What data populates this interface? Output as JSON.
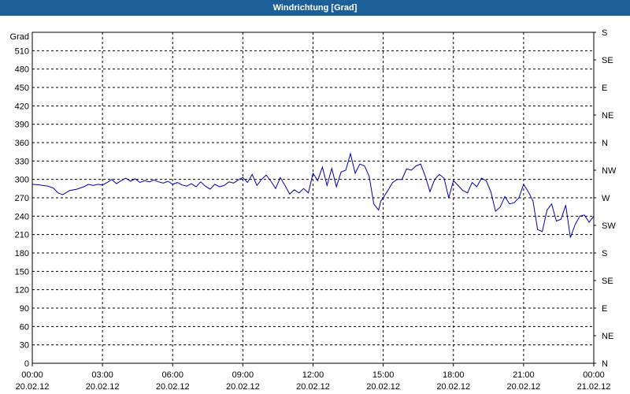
{
  "window": {
    "title": "Windrichtung [Grad]"
  },
  "chart_data": {
    "type": "line",
    "title": "Windrichtung [Grad]",
    "ylabel": "Grad",
    "ylim": [
      0,
      540
    ],
    "y_ticks": [
      0,
      30,
      60,
      90,
      120,
      150,
      180,
      210,
      240,
      270,
      300,
      330,
      360,
      390,
      420,
      450,
      480,
      510
    ],
    "right_axis_labels": [
      {
        "value": 0,
        "label": "N"
      },
      {
        "value": 45,
        "label": "NE"
      },
      {
        "value": 90,
        "label": "E"
      },
      {
        "value": 135,
        "label": "SE"
      },
      {
        "value": 180,
        "label": "S"
      },
      {
        "value": 225,
        "label": "SW"
      },
      {
        "value": 270,
        "label": "W"
      },
      {
        "value": 315,
        "label": "NW"
      },
      {
        "value": 360,
        "label": "N"
      },
      {
        "value": 405,
        "label": "NE"
      },
      {
        "value": 450,
        "label": "E"
      },
      {
        "value": 495,
        "label": "SE"
      },
      {
        "value": 540,
        "label": "S"
      }
    ],
    "xlim": [
      0,
      24
    ],
    "x_ticks": [
      {
        "hour": 0,
        "time": "00:00",
        "date": "20.02.12"
      },
      {
        "hour": 3,
        "time": "03:00",
        "date": "20.02.12"
      },
      {
        "hour": 6,
        "time": "06:00",
        "date": "20.02.12"
      },
      {
        "hour": 9,
        "time": "09:00",
        "date": "20.02.12"
      },
      {
        "hour": 12,
        "time": "12:00",
        "date": "20.02.12"
      },
      {
        "hour": 15,
        "time": "15:00",
        "date": "20.02.12"
      },
      {
        "hour": 18,
        "time": "18:00",
        "date": "20.02.12"
      },
      {
        "hour": 21,
        "time": "21:00",
        "date": "20.02.12"
      },
      {
        "hour": 24,
        "time": "00:00",
        "date": "21.02.12"
      }
    ],
    "grid": true,
    "series": [
      {
        "color": "#0000aa",
        "x": [
          0,
          0.33,
          0.67,
          0.9,
          1.1,
          1.3,
          1.6,
          1.9,
          2.2,
          2.4,
          2.6,
          2.8,
          3.0,
          3.2,
          3.4,
          3.6,
          3.8,
          4.0,
          4.2,
          4.4,
          4.6,
          4.8,
          5.0,
          5.2,
          5.4,
          5.6,
          5.8,
          6.0,
          6.2,
          6.4,
          6.6,
          6.8,
          7.0,
          7.2,
          7.4,
          7.6,
          7.8,
          8.0,
          8.2,
          8.4,
          8.6,
          8.8,
          9.0,
          9.2,
          9.4,
          9.6,
          9.8,
          10.0,
          10.2,
          10.4,
          10.6,
          10.8,
          11.0,
          11.2,
          11.4,
          11.6,
          11.8,
          12.0,
          12.2,
          12.4,
          12.6,
          12.8,
          13.0,
          13.2,
          13.4,
          13.6,
          13.8,
          14.0,
          14.2,
          14.4,
          14.6,
          14.8,
          14.9,
          15.0,
          15.2,
          15.4,
          15.6,
          15.8,
          16.0,
          16.2,
          16.4,
          16.6,
          16.8,
          17.0,
          17.2,
          17.4,
          17.6,
          17.8,
          18.0,
          18.2,
          18.4,
          18.6,
          18.8,
          19.0,
          19.2,
          19.4,
          19.6,
          19.8,
          20.0,
          20.2,
          20.4,
          20.6,
          20.8,
          21.0,
          21.2,
          21.4,
          21.6,
          21.8,
          22.0,
          22.2,
          22.4,
          22.6,
          22.8,
          23.0,
          23.2,
          23.4,
          23.6,
          23.8,
          24.0
        ],
        "y": [
          292,
          291,
          289,
          286,
          278,
          275,
          282,
          284,
          288,
          292,
          290,
          292,
          291,
          295,
          300,
          293,
          298,
          302,
          297,
          301,
          295,
          298,
          296,
          299,
          296,
          294,
          297,
          292,
          295,
          291,
          289,
          293,
          288,
          296,
          289,
          284,
          292,
          288,
          290,
          296,
          294,
          299,
          303,
          295,
          308,
          290,
          300,
          307,
          297,
          285,
          303,
          290,
          276,
          283,
          278,
          285,
          278,
          310,
          298,
          320,
          290,
          318,
          288,
          312,
          315,
          342,
          310,
          325,
          322,
          305,
          260,
          250,
          265,
          270,
          282,
          295,
          300,
          300,
          317,
          315,
          322,
          325,
          305,
          280,
          300,
          308,
          302,
          270,
          298,
          290,
          282,
          278,
          295,
          288,
          302,
          298,
          280,
          248,
          255,
          272,
          260,
          262,
          270,
          292,
          280,
          265,
          218,
          215,
          250,
          260,
          232,
          235,
          258,
          205,
          226,
          240,
          242,
          230,
          240
        ]
      }
    ]
  }
}
